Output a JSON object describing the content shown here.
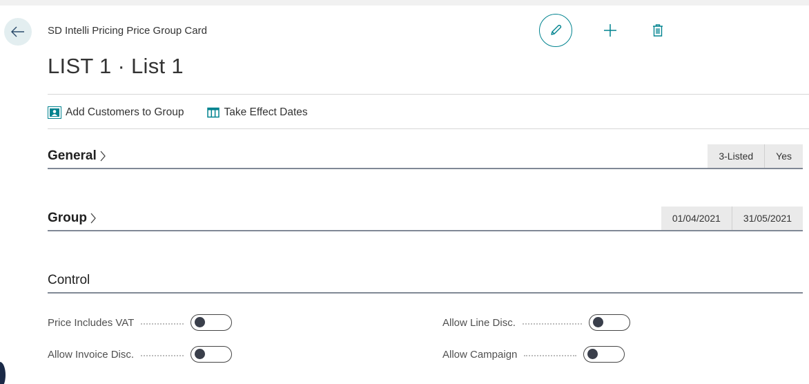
{
  "header": {
    "caption": "SD Intelli Pricing Price Group Card",
    "title": "LIST 1 · List 1"
  },
  "actions": [
    {
      "label": "Add Customers to Group",
      "icon": "customers-group-icon"
    },
    {
      "label": "Take Effect Dates",
      "icon": "table-columns-icon"
    }
  ],
  "fasttabs": {
    "general": {
      "title": "General",
      "summary": [
        "3-Listed",
        "Yes"
      ]
    },
    "group": {
      "title": "Group",
      "summary": [
        "01/04/2021",
        "31/05/2021"
      ]
    },
    "control": {
      "title": "Control"
    }
  },
  "fields": {
    "price_includes_vat": {
      "label": "Price Includes VAT",
      "value": false
    },
    "allow_invoice_disc": {
      "label": "Allow Invoice Disc.",
      "value": false
    },
    "allow_line_disc": {
      "label": "Allow Line Disc.",
      "value": false
    },
    "allow_campaign": {
      "label": "Allow Campaign",
      "value": false
    }
  },
  "colors": {
    "accent": "#00838f",
    "back_button_bg": "#e3eef0",
    "summary_bg": "#eaeaea"
  }
}
